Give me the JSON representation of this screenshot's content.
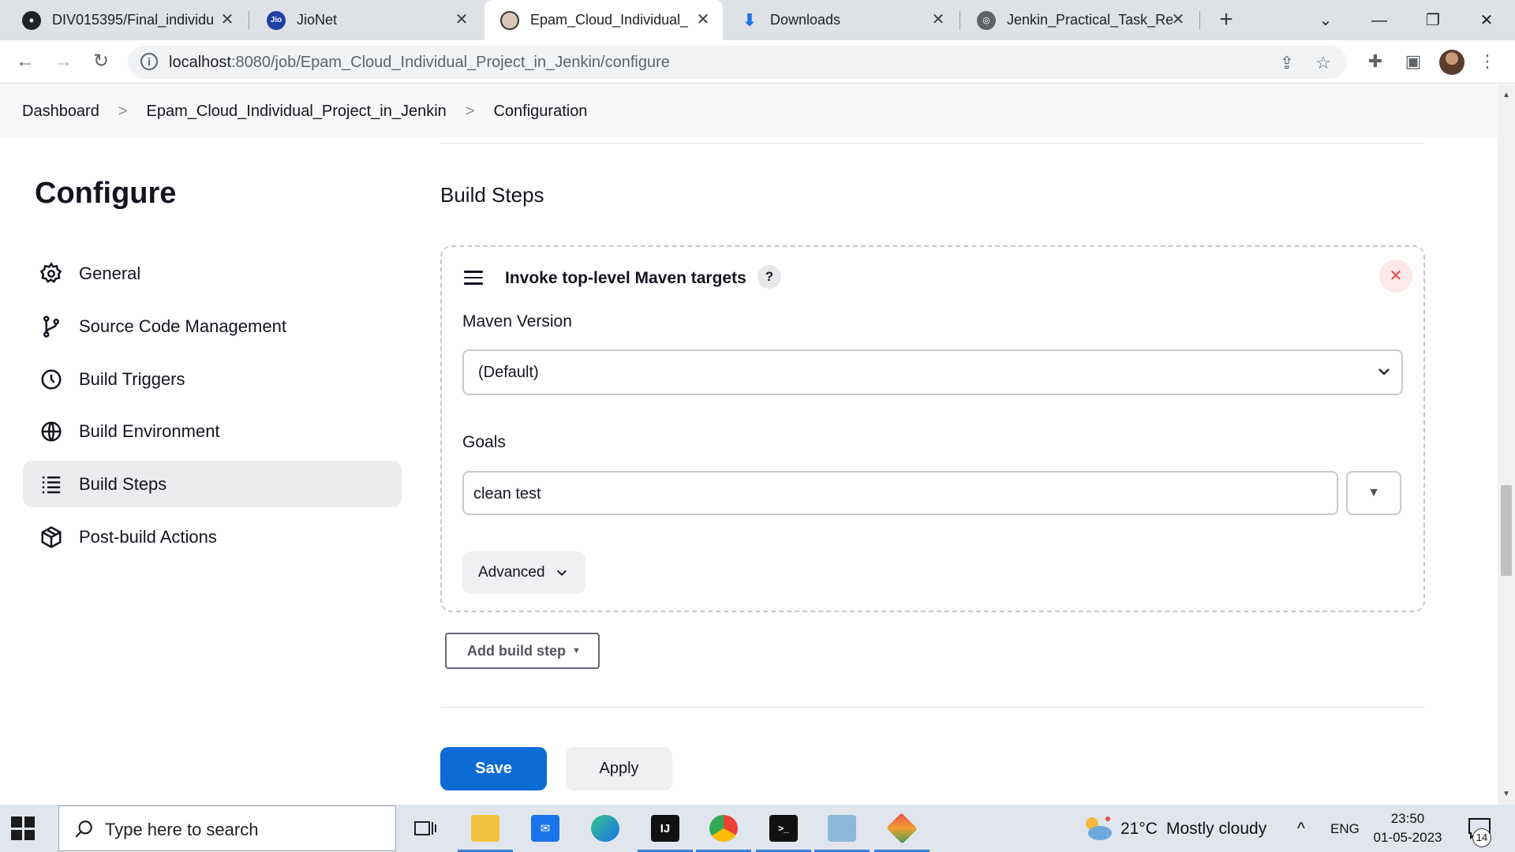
{
  "browser": {
    "tabs": [
      {
        "title": "DIV015395/Final_individu",
        "favicon": "github-icon"
      },
      {
        "title": "JioNet",
        "favicon": "jio-icon"
      },
      {
        "title": "Epam_Cloud_Individual_P",
        "favicon": "jenkins-icon",
        "active": true
      },
      {
        "title": "Downloads",
        "favicon": "download-icon"
      },
      {
        "title": "Jenkin_Practical_Task_Rep",
        "favicon": "globe-icon"
      }
    ],
    "url_host": "localhost",
    "url_path": ":8080/job/Epam_Cloud_Individual_Project_in_Jenkin/configure",
    "jio_favicon_text": "Jio"
  },
  "breadcrumb": {
    "items": [
      "Dashboard",
      "Epam_Cloud_Individual_Project_in_Jenkin",
      "Configuration"
    ],
    "separator": ">"
  },
  "sidebar": {
    "title": "Configure",
    "items": [
      {
        "label": "General",
        "icon": "gear-icon"
      },
      {
        "label": "Source Code Management",
        "icon": "branch-icon"
      },
      {
        "label": "Build Triggers",
        "icon": "clock-icon"
      },
      {
        "label": "Build Environment",
        "icon": "globe-icon"
      },
      {
        "label": "Build Steps",
        "icon": "list-icon",
        "active": true
      },
      {
        "label": "Post-build Actions",
        "icon": "package-icon"
      }
    ]
  },
  "main": {
    "section_title": "Build Steps",
    "step": {
      "title": "Invoke top-level Maven targets",
      "help": "?",
      "close": "✕",
      "maven_version_label": "Maven Version",
      "maven_version_value": "(Default)",
      "goals_label": "Goals",
      "goals_value": "clean test",
      "advanced_label": "Advanced"
    },
    "add_build_step_label": "Add build step",
    "save_label": "Save",
    "apply_label": "Apply"
  },
  "taskbar": {
    "search_placeholder": "Type here to search",
    "intellij_text": "IJ",
    "weather_temp": "21°C",
    "weather_text": "Mostly cloudy",
    "tray_chevron": "^",
    "language": "ENG",
    "time": "23:50",
    "date": "01-05-2023",
    "notification_count": "14"
  },
  "colors": {
    "save_button": "#0b6bd3",
    "close_button_bg": "#fde9ea",
    "close_button_fg": "#e5484d",
    "active_sidebar_bg": "#ececef"
  }
}
